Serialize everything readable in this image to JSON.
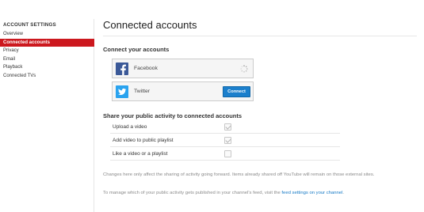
{
  "sidebar": {
    "heading": "ACCOUNT SETTINGS",
    "items": [
      {
        "label": "Overview",
        "active": false
      },
      {
        "label": "Connected accounts",
        "active": true
      },
      {
        "label": "Privacy",
        "active": false
      },
      {
        "label": "Email",
        "active": false
      },
      {
        "label": "Playback",
        "active": false
      },
      {
        "label": "Connected TVs",
        "active": false
      }
    ]
  },
  "main": {
    "title": "Connected accounts",
    "connect_section": {
      "title": "Connect your accounts",
      "accounts": [
        {
          "name": "Facebook",
          "icon": "facebook-icon",
          "state": "loading"
        },
        {
          "name": "Twitter",
          "icon": "twitter-icon",
          "button_label": "Connect"
        }
      ]
    },
    "share_section": {
      "title": "Share your public activity to connected accounts",
      "activities": [
        {
          "label": "Upload a video",
          "checked": true
        },
        {
          "label": "Add video to public playlist",
          "checked": true
        },
        {
          "label": "Like a video or a playlist",
          "checked": false
        }
      ]
    },
    "notes": {
      "changes": "Changes here only affect the sharing of activity going forward. Items already shared off YouTube will remain on those external sites.",
      "manage_prefix": "To manage which of your public activity gets published in your channel's feed, visit the ",
      "manage_link": "feed settings on your channel",
      "manage_suffix": "."
    }
  },
  "colors": {
    "active_nav": "#cc181e",
    "facebook": "#3b5998",
    "twitter": "#2aa3ef",
    "connect_button": "#1b7fcc",
    "link": "#167ac6"
  }
}
